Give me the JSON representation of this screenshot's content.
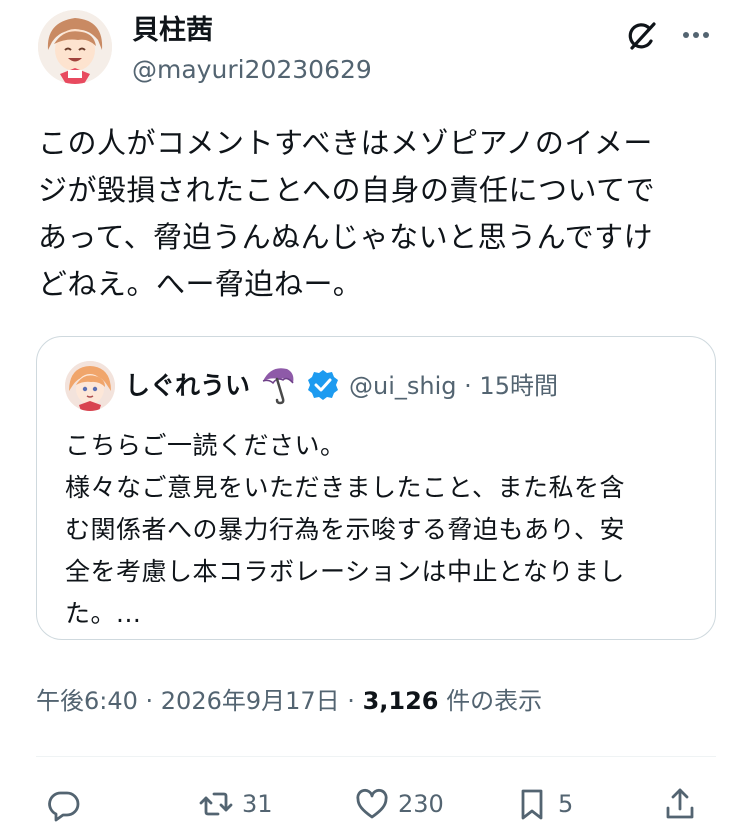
{
  "tweet": {
    "author": {
      "name": "貝柱茜",
      "handle": "@mayuri20230629"
    },
    "text": "この人がコメントすべきはメゾピアノのイメー\nジが毀損されたことへの自身の責任についてで\nあって、脅迫うんぬんじゃないと思うんですけ\nどねえ。へー脅迫ねー。",
    "quoted": {
      "name": "しぐれうい",
      "handle": "@ui_shig",
      "separator": "·",
      "time": "15時間",
      "text": "こちらご一読ください。\n様々なご意見をいただきましたこと、また私を含\nむ関係者への暴力行為を示唆する脅迫もあり、安\n全を考慮し本コラボレーションは中止となりまし\nた。..."
    },
    "timestamp": "午後6:40 · 2026年9月17日 · ",
    "views_count": "3,126",
    "views_label": " 件の表示",
    "actions": {
      "reply_count": "",
      "repost_count": "31",
      "like_count": "230",
      "bookmark_count": "5"
    }
  },
  "icons": {
    "grok": "grok-icon",
    "more": "more-icon",
    "verified": "verified-badge-icon",
    "umbrella": "umbrella-emoji-icon",
    "reply": "reply-icon",
    "repost": "repost-icon",
    "like": "heart-icon",
    "bookmark": "bookmark-icon",
    "share": "share-icon"
  },
  "colors": {
    "text": "#0f1419",
    "secondary": "#536471",
    "border": "#cfd9de",
    "verified": "#1d9bf0"
  }
}
